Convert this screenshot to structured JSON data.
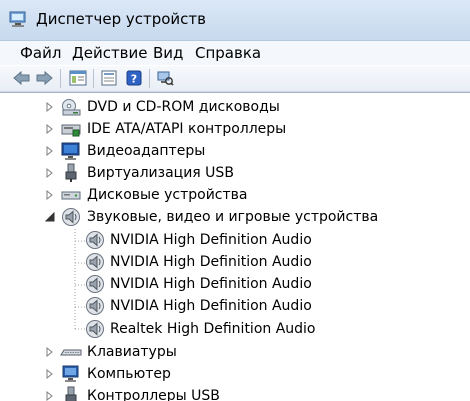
{
  "window": {
    "title": "Диспетчер устройств"
  },
  "menu": {
    "file": "Файл",
    "action": "Действие",
    "view": "Вид",
    "help": "Справка"
  },
  "toolbar": {
    "buttons": [
      "back-icon",
      "forward-icon",
      "console-tree-icon",
      "properties-icon",
      "help-icon",
      "scan-hardware-icon"
    ]
  },
  "tree": {
    "categories": [
      {
        "label": "DVD и CD-ROM дисководы",
        "icon": "dvd-drive-icon",
        "expanded": false
      },
      {
        "label": "IDE ATA/ATAPI контроллеры",
        "icon": "ide-controller-icon",
        "expanded": false
      },
      {
        "label": "Видеоадаптеры",
        "icon": "display-adapter-icon",
        "expanded": false
      },
      {
        "label": "Виртуализация USB",
        "icon": "usb-virtualization-icon",
        "expanded": false
      },
      {
        "label": "Дисковые устройства",
        "icon": "disk-drive-icon",
        "expanded": false
      },
      {
        "label": "Звуковые, видео и игровые устройства",
        "icon": "sound-device-icon",
        "expanded": true
      },
      {
        "label": "Клавиатуры",
        "icon": "keyboard-icon",
        "expanded": false
      },
      {
        "label": "Компьютер",
        "icon": "computer-icon",
        "expanded": false
      },
      {
        "label": "Контроллеры USB",
        "icon": "usb-controller-icon",
        "expanded": false
      }
    ],
    "sound_children": [
      {
        "label": "NVIDIA High Definition Audio",
        "icon": "audio-device-icon"
      },
      {
        "label": "NVIDIA High Definition Audio",
        "icon": "audio-device-icon"
      },
      {
        "label": "NVIDIA High Definition Audio",
        "icon": "audio-device-icon"
      },
      {
        "label": "NVIDIA High Definition Audio",
        "icon": "audio-device-icon"
      },
      {
        "label": "Realtek High Definition Audio",
        "icon": "audio-device-icon"
      }
    ]
  },
  "colors": {
    "titlebar": "#dbe8f6",
    "tree_line": "#a0a0a0"
  }
}
